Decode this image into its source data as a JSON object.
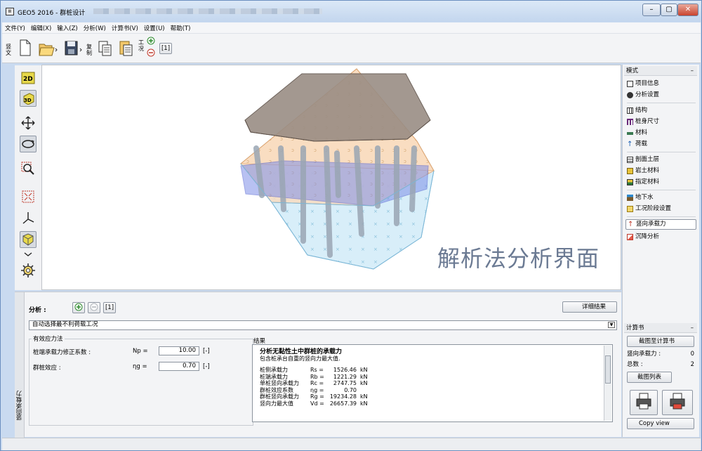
{
  "window": {
    "title": "GEO5 2016 - 群桩设计",
    "app_icon": "Ⅲ"
  },
  "menu": [
    "文件(Y)",
    "编辑(X)",
    "输入(Z)",
    "分析(W)",
    "计算书(V)",
    "设置(U)",
    "帮助(T)"
  ],
  "toolbar": {
    "side_label": "竖文",
    "copy_label": "复制",
    "stage_label": "工况",
    "stage_number": "[1]"
  },
  "viewport": {
    "watermark": "解析法分析界面"
  },
  "right_panel": {
    "mode_header": "模式",
    "mode_items": [
      "项目信息",
      "分析设置",
      "结构",
      "桩身尺寸",
      "材料",
      "荷载",
      "剖面土层",
      "岩土材料",
      "指定材料",
      "地下水",
      "工况阶段设置",
      "竖向承载力",
      "沉降分析"
    ],
    "active_item": "竖向承载力",
    "report_header": "计算书",
    "report_button": "截图至计算书",
    "vertical_label": "竖向承载力 :",
    "vertical_count": "0",
    "total_label": "总数 :",
    "total_count": "2",
    "list_button": "截图列表",
    "copy_view": "Copy view"
  },
  "bottom": {
    "side_tab": "竖向承载力",
    "analysis_label": "分析 :",
    "analysis_number": "[1]",
    "detail_button": "详细结果",
    "dropdown_value": "自动选择最不利荷载工况",
    "group_title": "有效应力法",
    "param1_label": "桩端承载力修正系数 :",
    "param1_symbol": "Np =",
    "param1_value": "10.00",
    "param1_unit": "[-]",
    "param2_label": "群桩效应 :",
    "param2_symbol": "ηg =",
    "param2_value": "0.70",
    "param2_unit": "[-]",
    "results_title": "结果",
    "results_heading": "分析无黏性土中群桩的承载力",
    "results_sub": "包含桩承台自重的竖向力最大值.",
    "rows": [
      {
        "label": "桩侧承载力",
        "sym": "Rs =",
        "val": "1526.46",
        "unit": "kN"
      },
      {
        "label": "桩端承载力",
        "sym": "Rb =",
        "val": "1221.29",
        "unit": "kN"
      },
      {
        "label": "单桩竖向承载力",
        "sym": "Rc =",
        "val": "2747.75",
        "unit": "kN"
      },
      {
        "label": "群桩效应系数",
        "sym": "ηg =",
        "val": "0.70",
        "unit": ""
      },
      {
        "label": "群桩竖向承载力",
        "sym": "Rg =",
        "val": "19234.28",
        "unit": "kN"
      },
      {
        "label": "竖向力最大值",
        "sym": "Vd =",
        "val": "26657.39",
        "unit": "kN"
      }
    ]
  }
}
